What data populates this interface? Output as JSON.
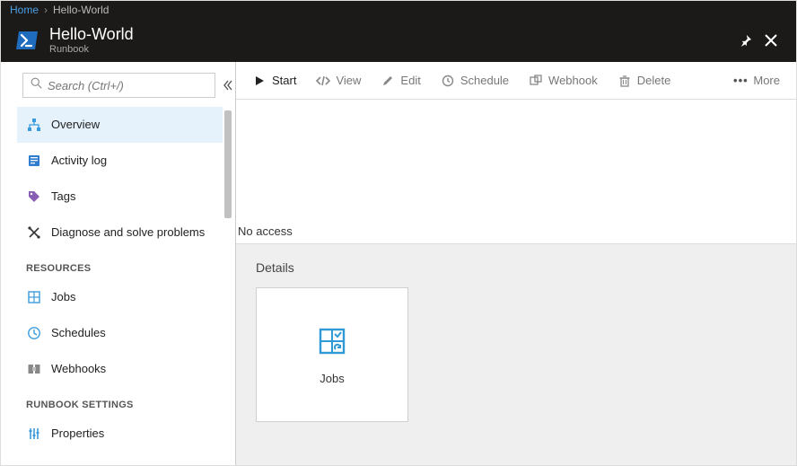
{
  "breadcrumb": {
    "home": "Home",
    "current": "Hello-World"
  },
  "header": {
    "title": "Hello-World",
    "subtitle": "Runbook"
  },
  "search": {
    "placeholder": "Search (Ctrl+/)"
  },
  "sidebar": {
    "top": [
      {
        "label": "Overview",
        "icon": "sitemap"
      },
      {
        "label": "Activity log",
        "icon": "log"
      },
      {
        "label": "Tags",
        "icon": "tag"
      },
      {
        "label": "Diagnose and solve problems",
        "icon": "tools"
      }
    ],
    "groups": [
      {
        "label": "RESOURCES",
        "items": [
          {
            "label": "Jobs",
            "icon": "jobs"
          },
          {
            "label": "Schedules",
            "icon": "clock"
          },
          {
            "label": "Webhooks",
            "icon": "webhook"
          }
        ]
      },
      {
        "label": "RUNBOOK SETTINGS",
        "items": [
          {
            "label": "Properties",
            "icon": "properties"
          }
        ]
      }
    ]
  },
  "toolbar": {
    "start": "Start",
    "view": "View",
    "edit": "Edit",
    "schedule": "Schedule",
    "webhook": "Webhook",
    "delete": "Delete",
    "more": "More"
  },
  "content": {
    "no_access": "No access",
    "details_title": "Details",
    "tiles": [
      {
        "label": "Jobs",
        "icon": "jobs-tile"
      }
    ]
  }
}
